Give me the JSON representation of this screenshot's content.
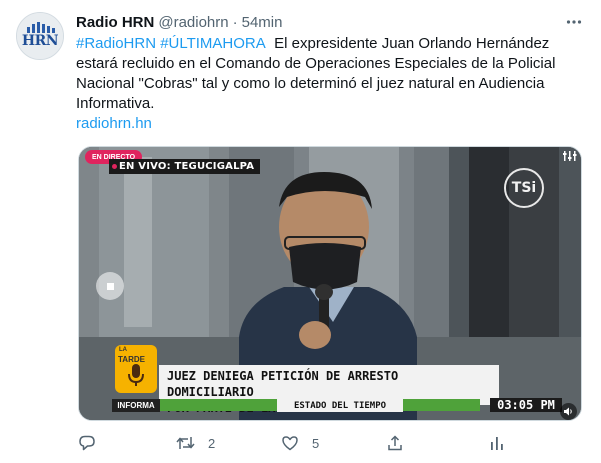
{
  "tweet": {
    "author_name": "Radio HRN",
    "handle": "@radiohrn",
    "separator": "·",
    "time": "54min",
    "hashtags": "#RadioHRN #ÚLTIMAHORA",
    "body": "El expresidente Juan Orlando Hernández estará recluido en el Comando de Operaciones Especiales de la Policial Nacional \"Cobras\" tal y como lo determinó el juez natural en Audiencia Informativa.",
    "link": "radiohrn.hn",
    "avatar_text": "HRN"
  },
  "media": {
    "live_badge": "EN DIRECTO",
    "live_location": "EN VIVO: TEGUCIGALPA",
    "channel_logo": "TSi",
    "show_logo_small": "LA",
    "show_logo_name": "TARDE",
    "headline_line1": "JUEZ DENIEGA PETICIÓN DE ARRESTO DOMICILIARIO",
    "headline_line2": "POR PARTE DE LA DEFENSA",
    "informa_label": "INFORMA",
    "ticker": "ESTADO DEL TIEMPO",
    "clock": "03:05 PM"
  },
  "actions": {
    "reply_count": "",
    "retweet_count": "2",
    "like_count": "5",
    "share_count": ""
  },
  "colors": {
    "accent": "#1d9bf0",
    "secondary_text": "#536471",
    "live_red": "#e0245e",
    "ticker_green": "#4fa23a",
    "show_logo_yellow": "#f6b200"
  }
}
